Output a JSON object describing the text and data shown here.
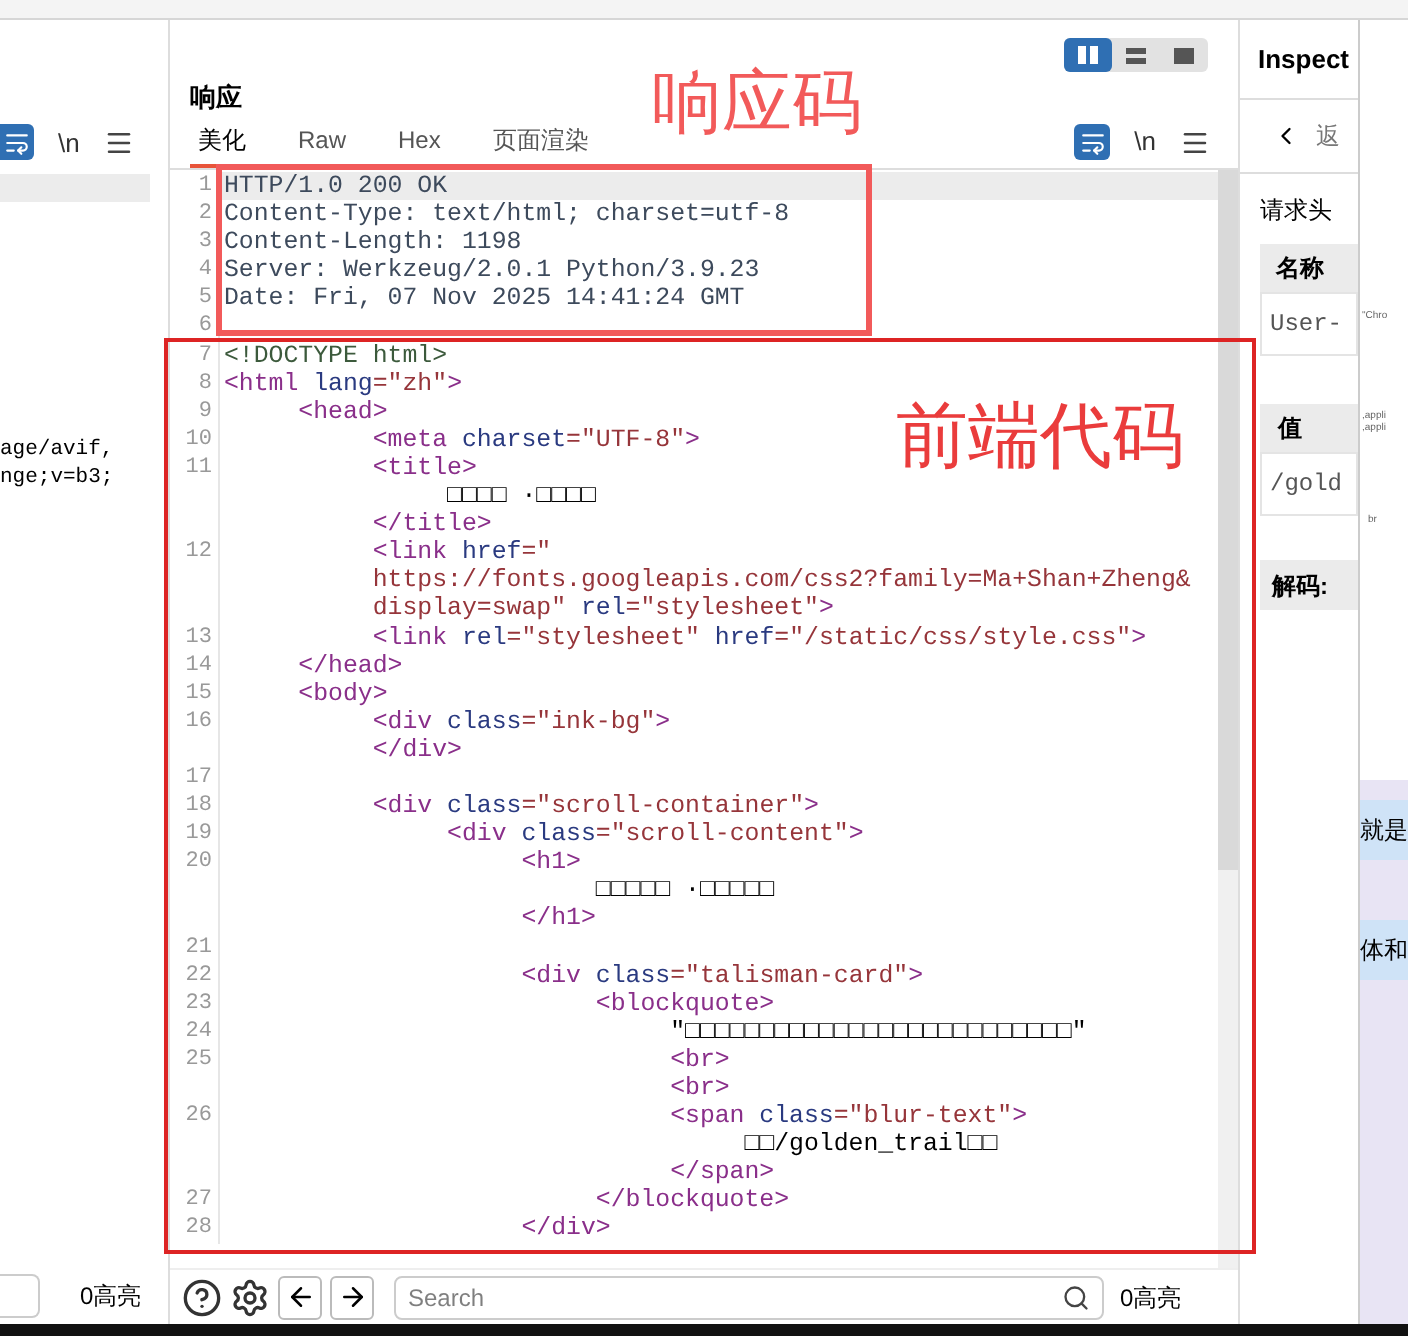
{
  "left_panel": {
    "newline_label": "\\n",
    "lines": [
      "age/avif,",
      "nge;v=b3;"
    ],
    "highlight_count": "0高亮"
  },
  "response_panel": {
    "title": "响应",
    "tabs": [
      {
        "label": "美化",
        "selected": true
      },
      {
        "label": "Raw",
        "selected": false
      },
      {
        "label": "Hex",
        "selected": false
      },
      {
        "label": "页面渲染",
        "selected": false
      }
    ],
    "layout_modes": [
      {
        "kind": "columns",
        "selected": true
      },
      {
        "kind": "rows",
        "selected": false
      },
      {
        "kind": "single",
        "selected": false
      }
    ],
    "newline_label": "\\n",
    "code_rows": [
      {
        "num": "1",
        "current": true,
        "segments": [
          {
            "kind": "header",
            "text": "HTTP/1.0 200 OK"
          }
        ]
      },
      {
        "num": "2",
        "current": false,
        "segments": [
          {
            "kind": "header",
            "text": "Content-Type: text/html; charset=utf-8"
          }
        ]
      },
      {
        "num": "3",
        "current": false,
        "segments": [
          {
            "kind": "header",
            "text": "Content-Length: 1198"
          }
        ]
      },
      {
        "num": "4",
        "current": false,
        "segments": [
          {
            "kind": "header",
            "text": "Server: Werkzeug/2.0.1 Python/3.9.23"
          }
        ]
      },
      {
        "num": "5",
        "current": false,
        "segments": [
          {
            "kind": "header",
            "text": "Date: Fri, 07 Nov 2025 14:41:24 GMT"
          }
        ]
      },
      {
        "num": "6",
        "current": false,
        "segments": []
      },
      {
        "num": "7",
        "current": false,
        "segments": [
          {
            "kind": "doctype",
            "text": "<!DOCTYPE html>"
          }
        ]
      },
      {
        "num": "8",
        "current": false,
        "segments": [
          {
            "kind": "tag",
            "text": "<html"
          },
          {
            "kind": "attr",
            "text": " lang"
          },
          {
            "kind": "value",
            "text": "=\"zh\""
          },
          {
            "kind": "tag",
            "text": ">"
          }
        ]
      },
      {
        "num": "9",
        "current": false,
        "segments": [
          {
            "kind": "tag",
            "text": "     <head>"
          }
        ]
      },
      {
        "num": "10",
        "current": false,
        "segments": [
          {
            "kind": "tag",
            "text": "          <meta"
          },
          {
            "kind": "attr",
            "text": " charset"
          },
          {
            "kind": "value",
            "text": "=\"UTF-8\""
          },
          {
            "kind": "tag",
            "text": ">"
          }
        ]
      },
      {
        "num": "11",
        "current": false,
        "segments": [
          {
            "kind": "tag",
            "text": "          <title>"
          }
        ]
      },
      {
        "current": false,
        "segments": [
          {
            "kind": "text",
            "text": "               □□□□ ·□□□□"
          }
        ]
      },
      {
        "current": false,
        "segments": [
          {
            "kind": "tag",
            "text": "          </title>"
          }
        ]
      },
      {
        "num": "12",
        "current": false,
        "segments": [
          {
            "kind": "tag",
            "text": "          <link"
          },
          {
            "kind": "attr",
            "text": " href"
          },
          {
            "kind": "value",
            "text": "=\""
          }
        ]
      },
      {
        "current": false,
        "segments": [
          {
            "kind": "value",
            "text": "          https://fonts.googleapis.com/css2?family=Ma+Shan+Zheng&"
          }
        ]
      },
      {
        "current": false,
        "segments": [
          {
            "kind": "value",
            "text": "          display=swap\""
          },
          {
            "kind": "attr",
            "text": " rel"
          },
          {
            "kind": "value",
            "text": "=\"stylesheet\""
          },
          {
            "kind": "tag",
            "text": ">"
          }
        ]
      },
      {
        "num": "13",
        "current": false,
        "segments": [
          {
            "kind": "tag",
            "text": "          <link"
          },
          {
            "kind": "attr",
            "text": " rel"
          },
          {
            "kind": "value",
            "text": "=\"stylesheet\""
          },
          {
            "kind": "attr",
            "text": " href"
          },
          {
            "kind": "value",
            "text": "=\"/static/css/style.css\""
          },
          {
            "kind": "tag",
            "text": ">"
          }
        ]
      },
      {
        "num": "14",
        "current": false,
        "segments": [
          {
            "kind": "tag",
            "text": "     </head>"
          }
        ]
      },
      {
        "num": "15",
        "current": false,
        "segments": [
          {
            "kind": "tag",
            "text": "     <body>"
          }
        ]
      },
      {
        "num": "16",
        "current": false,
        "segments": [
          {
            "kind": "tag",
            "text": "          <div"
          },
          {
            "kind": "attr",
            "text": " class"
          },
          {
            "kind": "value",
            "text": "=\"ink-bg\""
          },
          {
            "kind": "tag",
            "text": ">"
          }
        ]
      },
      {
        "current": false,
        "segments": [
          {
            "kind": "tag",
            "text": "          </div>"
          }
        ]
      },
      {
        "num": "17",
        "current": false,
        "segments": []
      },
      {
        "num": "18",
        "current": false,
        "segments": [
          {
            "kind": "tag",
            "text": "          <div"
          },
          {
            "kind": "attr",
            "text": " class"
          },
          {
            "kind": "value",
            "text": "=\"scroll-container\""
          },
          {
            "kind": "tag",
            "text": ">"
          }
        ]
      },
      {
        "num": "19",
        "current": false,
        "segments": [
          {
            "kind": "tag",
            "text": "               <div"
          },
          {
            "kind": "attr",
            "text": " class"
          },
          {
            "kind": "value",
            "text": "=\"scroll-content\""
          },
          {
            "kind": "tag",
            "text": ">"
          }
        ]
      },
      {
        "num": "20",
        "current": false,
        "segments": [
          {
            "kind": "tag",
            "text": "                    <h1>"
          }
        ]
      },
      {
        "current": false,
        "segments": [
          {
            "kind": "text",
            "text": "                         □□□□□ ·□□□□□"
          }
        ]
      },
      {
        "current": false,
        "segments": [
          {
            "kind": "tag",
            "text": "                    </h1>"
          }
        ]
      },
      {
        "num": "21",
        "current": false,
        "segments": []
      },
      {
        "num": "22",
        "current": false,
        "segments": [
          {
            "kind": "tag",
            "text": "                    <div"
          },
          {
            "kind": "attr",
            "text": " class"
          },
          {
            "kind": "value",
            "text": "=\"talisman-card\""
          },
          {
            "kind": "tag",
            "text": ">"
          }
        ]
      },
      {
        "num": "23",
        "current": false,
        "segments": [
          {
            "kind": "tag",
            "text": "                         <blockquote>"
          }
        ]
      },
      {
        "num": "24",
        "current": false,
        "segments": [
          {
            "kind": "text",
            "text": "                              \"□□□□□□□□□□□□□□□□□□□□□□□□□□\""
          }
        ]
      },
      {
        "num": "25",
        "current": false,
        "segments": [
          {
            "kind": "tag",
            "text": "                              <br>"
          }
        ]
      },
      {
        "current": false,
        "segments": [
          {
            "kind": "tag",
            "text": "                              <br>"
          }
        ]
      },
      {
        "num": "26",
        "current": false,
        "segments": [
          {
            "kind": "tag",
            "text": "                              <span"
          },
          {
            "kind": "attr",
            "text": " class"
          },
          {
            "kind": "value",
            "text": "=\"blur-text\""
          },
          {
            "kind": "tag",
            "text": ">"
          }
        ]
      },
      {
        "current": false,
        "segments": [
          {
            "kind": "text",
            "text": "                                   □□/golden_trail□□"
          }
        ]
      },
      {
        "current": false,
        "segments": [
          {
            "kind": "tag",
            "text": "                              </span>"
          }
        ]
      },
      {
        "num": "27",
        "current": false,
        "segments": [
          {
            "kind": "tag",
            "text": "                         </blockquote>"
          }
        ]
      },
      {
        "num": "28",
        "current": false,
        "segments": [
          {
            "kind": "tag",
            "text": "                    </div>"
          }
        ]
      }
    ],
    "search": {
      "placeholder": "Search"
    },
    "highlight_count": "0高亮"
  },
  "inspector": {
    "title": "Inspect",
    "back_label": "返",
    "section": "请求头",
    "name_header": "名称",
    "name_value": "User-",
    "value_header": "值",
    "value_value": "/gold",
    "decode_label": "解码:"
  },
  "background_window": {
    "fragments": [
      "\"Chro",
      ",appli",
      ",appli",
      "br"
    ],
    "snippets": [
      "就是",
      "体和"
    ]
  },
  "annotations": [
    {
      "kind": "header_box",
      "label": "响应码"
    },
    {
      "kind": "code_box",
      "label": "前端代码"
    }
  ]
}
